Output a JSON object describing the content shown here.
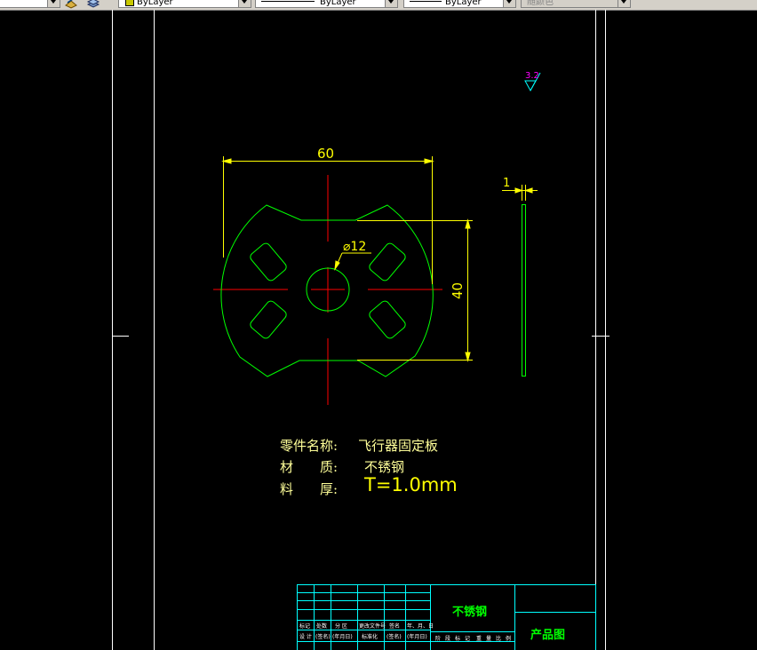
{
  "toolbar": {
    "color_value": "ByLayer",
    "linetype_value": "ByLayer",
    "lineweight_value": "ByLayer",
    "plotstyle_value": "随颜色"
  },
  "dimensions": {
    "width": "60",
    "height": "40",
    "hole_diameter": "⌀12",
    "thickness": "1",
    "surface_roughness": "3.2"
  },
  "notes": {
    "part_name_label": "零件名称:",
    "part_name_value": "飞行器固定板",
    "material_label": "材　　质:",
    "material_value": "不锈钢",
    "thickness_label": "料　　厚:",
    "thickness_value": "T=1.0mm"
  },
  "title_block": {
    "material": "不锈钢",
    "drawing_type": "产品图",
    "row_labels_upper": [
      "标记",
      "处数",
      "分 区",
      "更改文件号",
      "签名",
      "年、月、日"
    ],
    "row_labels_lower": [
      "设 计",
      "(签名)",
      "(年月日)",
      "标准化",
      "(签名)",
      "(年月日)"
    ],
    "stage_labels": [
      "阶",
      "段",
      "标",
      "记",
      "重",
      "量",
      "比",
      "例"
    ]
  },
  "colors": {
    "background": "#000000",
    "border": "#ffffff",
    "geometry": "#00ff00",
    "dimension": "#ffff00",
    "centerline": "#ff0000",
    "title_block_lines": "#00ffff",
    "roughness_symbol": "#ff00ff"
  }
}
